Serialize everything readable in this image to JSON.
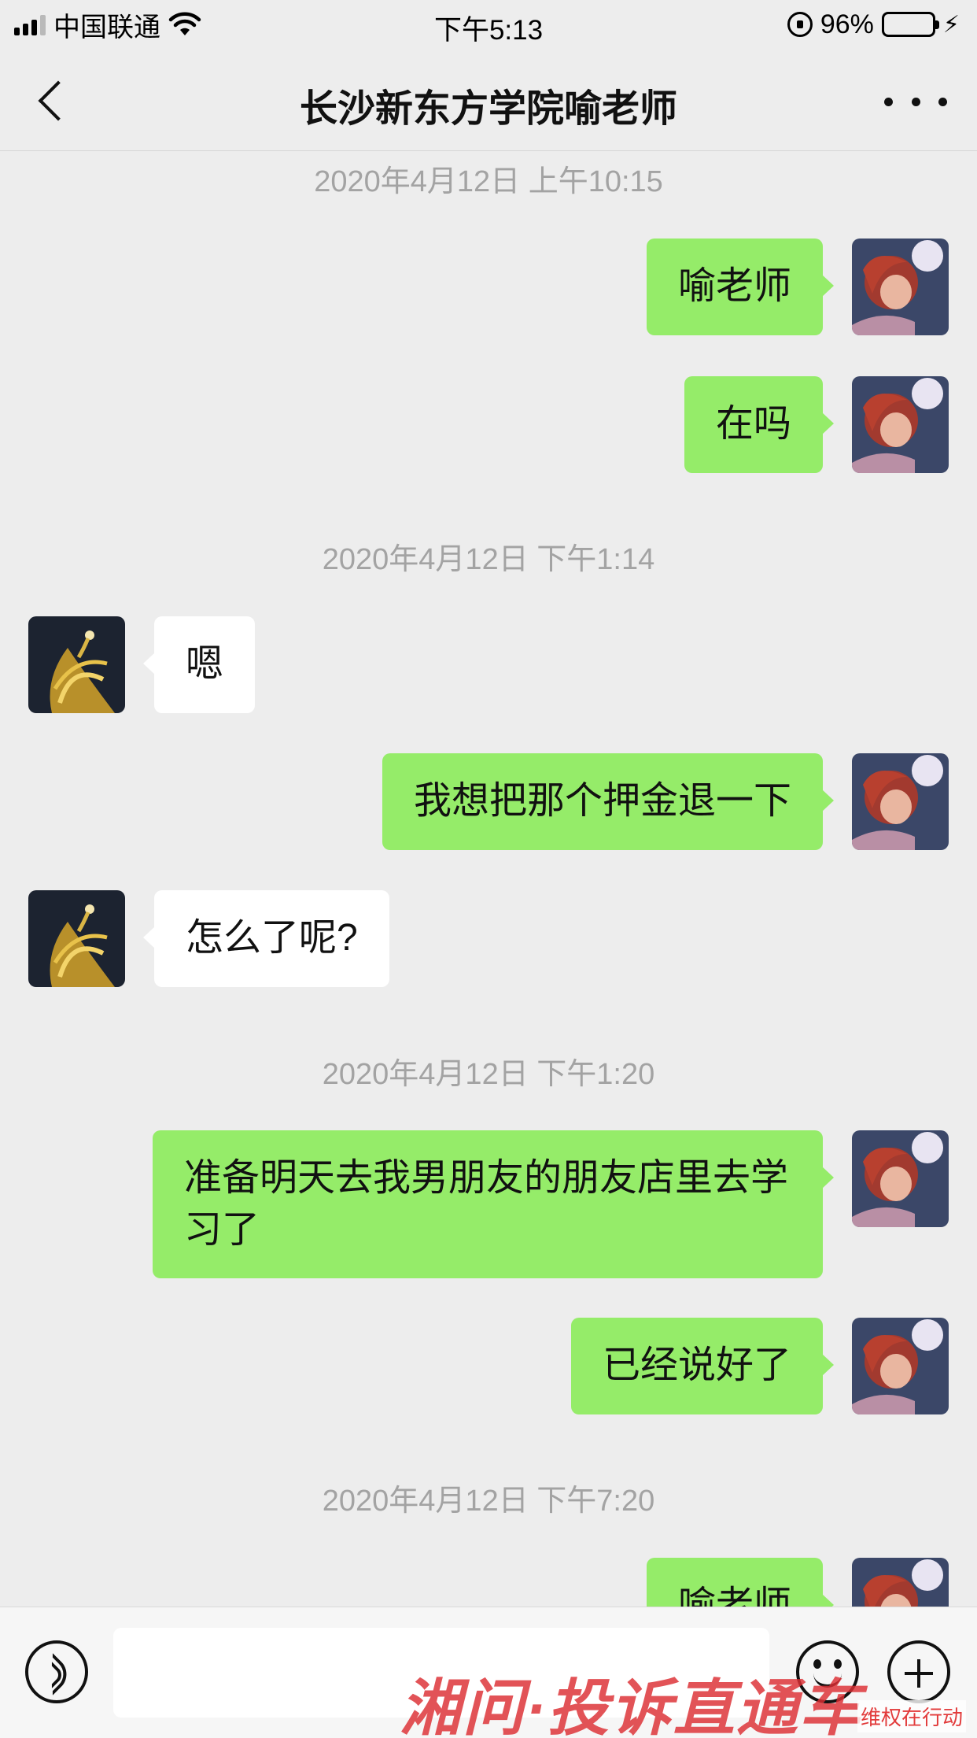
{
  "status_bar": {
    "carrier": "中国联通",
    "time": "下午5:13",
    "battery_percent": "96%",
    "battery_level": 0.96,
    "icons": [
      "signal-icon",
      "wifi-icon",
      "rotation-lock-icon",
      "battery-icon",
      "charging-icon"
    ]
  },
  "nav": {
    "title": "长沙新东方学院喻老师",
    "back_icon": "chevron-left-icon",
    "more_icon": "more-dots-icon"
  },
  "chat": {
    "timestamps": [
      "2020年4月12日 上午10:15",
      "2020年4月12日 下午1:14",
      "2020年4月12日 下午1:20",
      "2020年4月12日 下午7:20"
    ],
    "messages": [
      {
        "from": "me",
        "text": "喻老师"
      },
      {
        "from": "me",
        "text": "在吗"
      },
      {
        "from": "them",
        "text": "嗯"
      },
      {
        "from": "me",
        "text": "我想把那个押金退一下"
      },
      {
        "from": "them",
        "text": "怎么了呢?"
      },
      {
        "from": "me",
        "text": "准备明天去我男朋友的朋友店里去学习了"
      },
      {
        "from": "me",
        "text": "已经说好了"
      },
      {
        "from": "me",
        "text": "喻老师"
      }
    ]
  },
  "input_bar": {
    "placeholder": "",
    "icons": [
      "voice-icon",
      "emoji-icon",
      "plus-icon"
    ]
  },
  "watermark": {
    "main": "湘问·投诉直通车",
    "sub": "维权在行动"
  },
  "colors": {
    "background": "#ededed",
    "my_bubble": "#95ec69",
    "their_bubble": "#ffffff",
    "timestamp": "#a3a3a3",
    "watermark": "#dc2d32"
  }
}
